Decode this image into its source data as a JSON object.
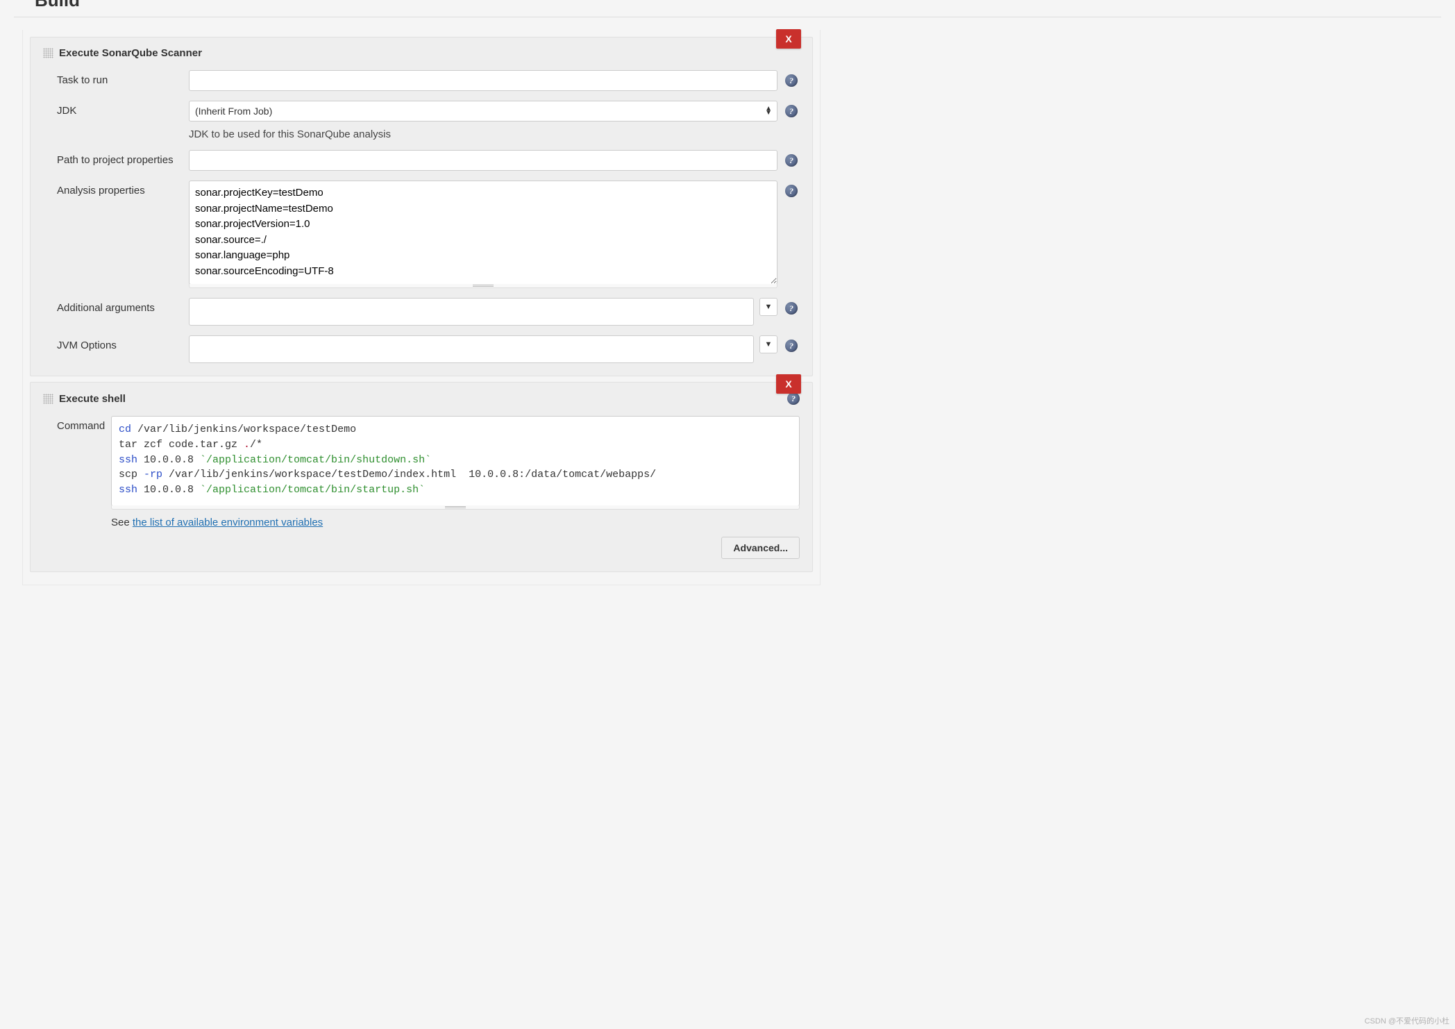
{
  "section_heading_cut": "Build",
  "sonar": {
    "title": "Execute SonarQube Scanner",
    "close_label": "X",
    "task_label": "Task to run",
    "task_value": "",
    "jdk_label": "JDK",
    "jdk_selected": "(Inherit From Job)",
    "jdk_help": "JDK to be used for this SonarQube analysis",
    "path_label": "Path to project properties",
    "path_value": "",
    "analysis_label": "Analysis properties",
    "analysis_value": "sonar.projectKey=testDemo\nsonar.projectName=testDemo\nsonar.projectVersion=1.0\nsonar.source=./\nsonar.language=php\nsonar.sourceEncoding=UTF-8",
    "addargs_label": "Additional arguments",
    "addargs_value": "",
    "jvm_label": "JVM Options",
    "jvm_value": "",
    "help_glyph": "?",
    "expand_glyph": "▼"
  },
  "shell": {
    "title": "Execute shell",
    "close_label": "X",
    "command_label": "Command",
    "cmd": {
      "t1a": "cd",
      "t1b": " /var/lib/jenkins/workspace/testDemo",
      "t2": "tar zcf code.tar.gz ",
      "t2d": ".",
      "t2e": "/*",
      "t3a": "ssh",
      "t3b": " 10.0.0.8 ",
      "t3s": "`/application/tomcat/bin/shutdown.sh`",
      "t4a": "scp ",
      "t4f": "-rp",
      "t4b": " /var/lib/jenkins/workspace/testDemo/index.html  10.0.0.8:/data/tomcat/webapps/",
      "t5a": "ssh",
      "t5b": " 10.0.0.8 ",
      "t5s": "`/application/tomcat/bin/startup.sh`"
    },
    "see_prefix": "See ",
    "see_link": "the list of available environment variables",
    "advanced": "Advanced..."
  },
  "watermark": "CSDN @不爱代码的小杜"
}
